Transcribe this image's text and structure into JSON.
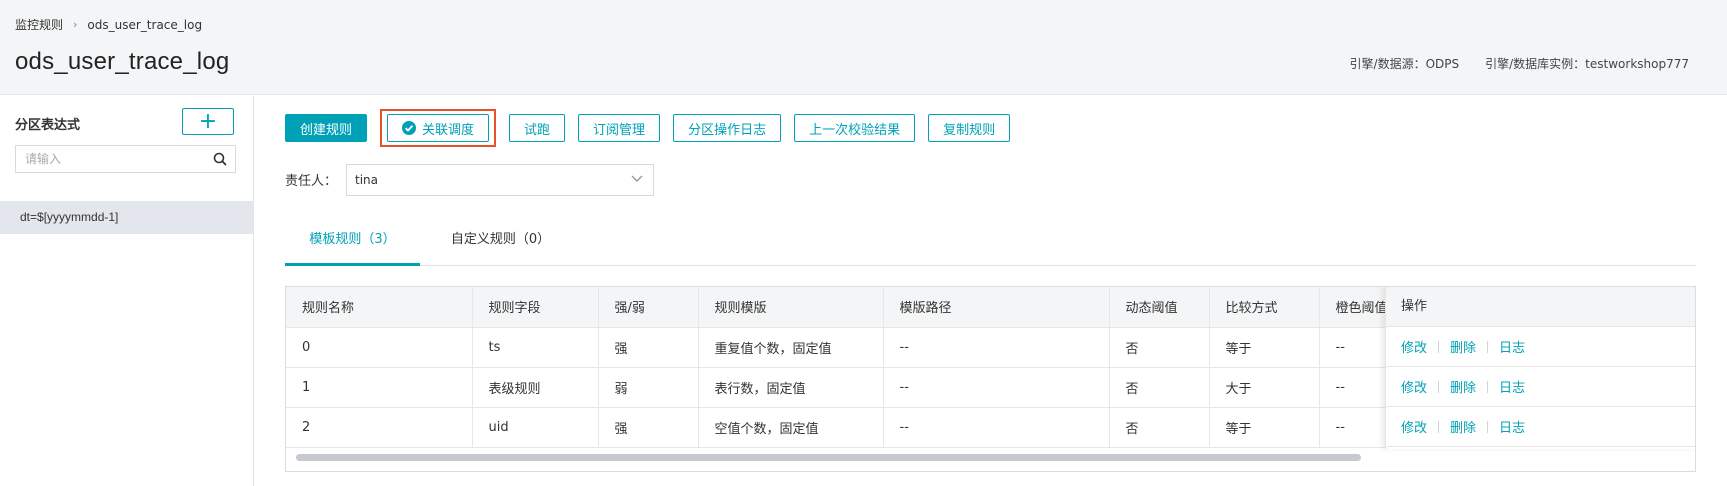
{
  "breadcrumb": {
    "parent": "监控规则",
    "separator": "›",
    "current": "ods_user_trace_log"
  },
  "page_title": "ods_user_trace_log",
  "meta": {
    "engine_source": "引擎/数据源：ODPS",
    "engine_instance": "引擎/数据库实例：testworkshop777"
  },
  "left_panel": {
    "title": "分区表达式",
    "add_label": "+",
    "search_placeholder": "请输入",
    "partitions": [
      "dt=$[yyyymmdd-1]"
    ]
  },
  "toolbar": {
    "create_rule": "创建规则",
    "link_schedule": "关联调度",
    "trial_run": "试跑",
    "subscription": "订阅管理",
    "partition_log": "分区操作日志",
    "last_result": "上一次校验结果",
    "copy_rule": "复制规则"
  },
  "owner": {
    "label": "责任人：",
    "value": "tina"
  },
  "tabs": {
    "template": "模板规则（3）",
    "custom": "自定义规则（0）"
  },
  "table": {
    "columns": [
      "规则名称",
      "规则字段",
      "强/弱",
      "规则模版",
      "模版路径",
      "动态阈值",
      "比较方式",
      "橙色阈值"
    ],
    "rows": [
      [
        "0",
        "ts",
        "强",
        "重复值个数，固定值",
        "--",
        "否",
        "等于",
        "--"
      ],
      [
        "1",
        "表级规则",
        "弱",
        "表行数，固定值",
        "--",
        "否",
        "大于",
        "--"
      ],
      [
        "2",
        "uid",
        "强",
        "空值个数，固定值",
        "--",
        "否",
        "等于",
        "--"
      ]
    ],
    "ops_header": "操作",
    "ops": {
      "edit": "修改",
      "delete": "删除",
      "log": "日志"
    }
  },
  "colors": {
    "accent": "#00a1b7",
    "highlight": "#e5512b"
  }
}
